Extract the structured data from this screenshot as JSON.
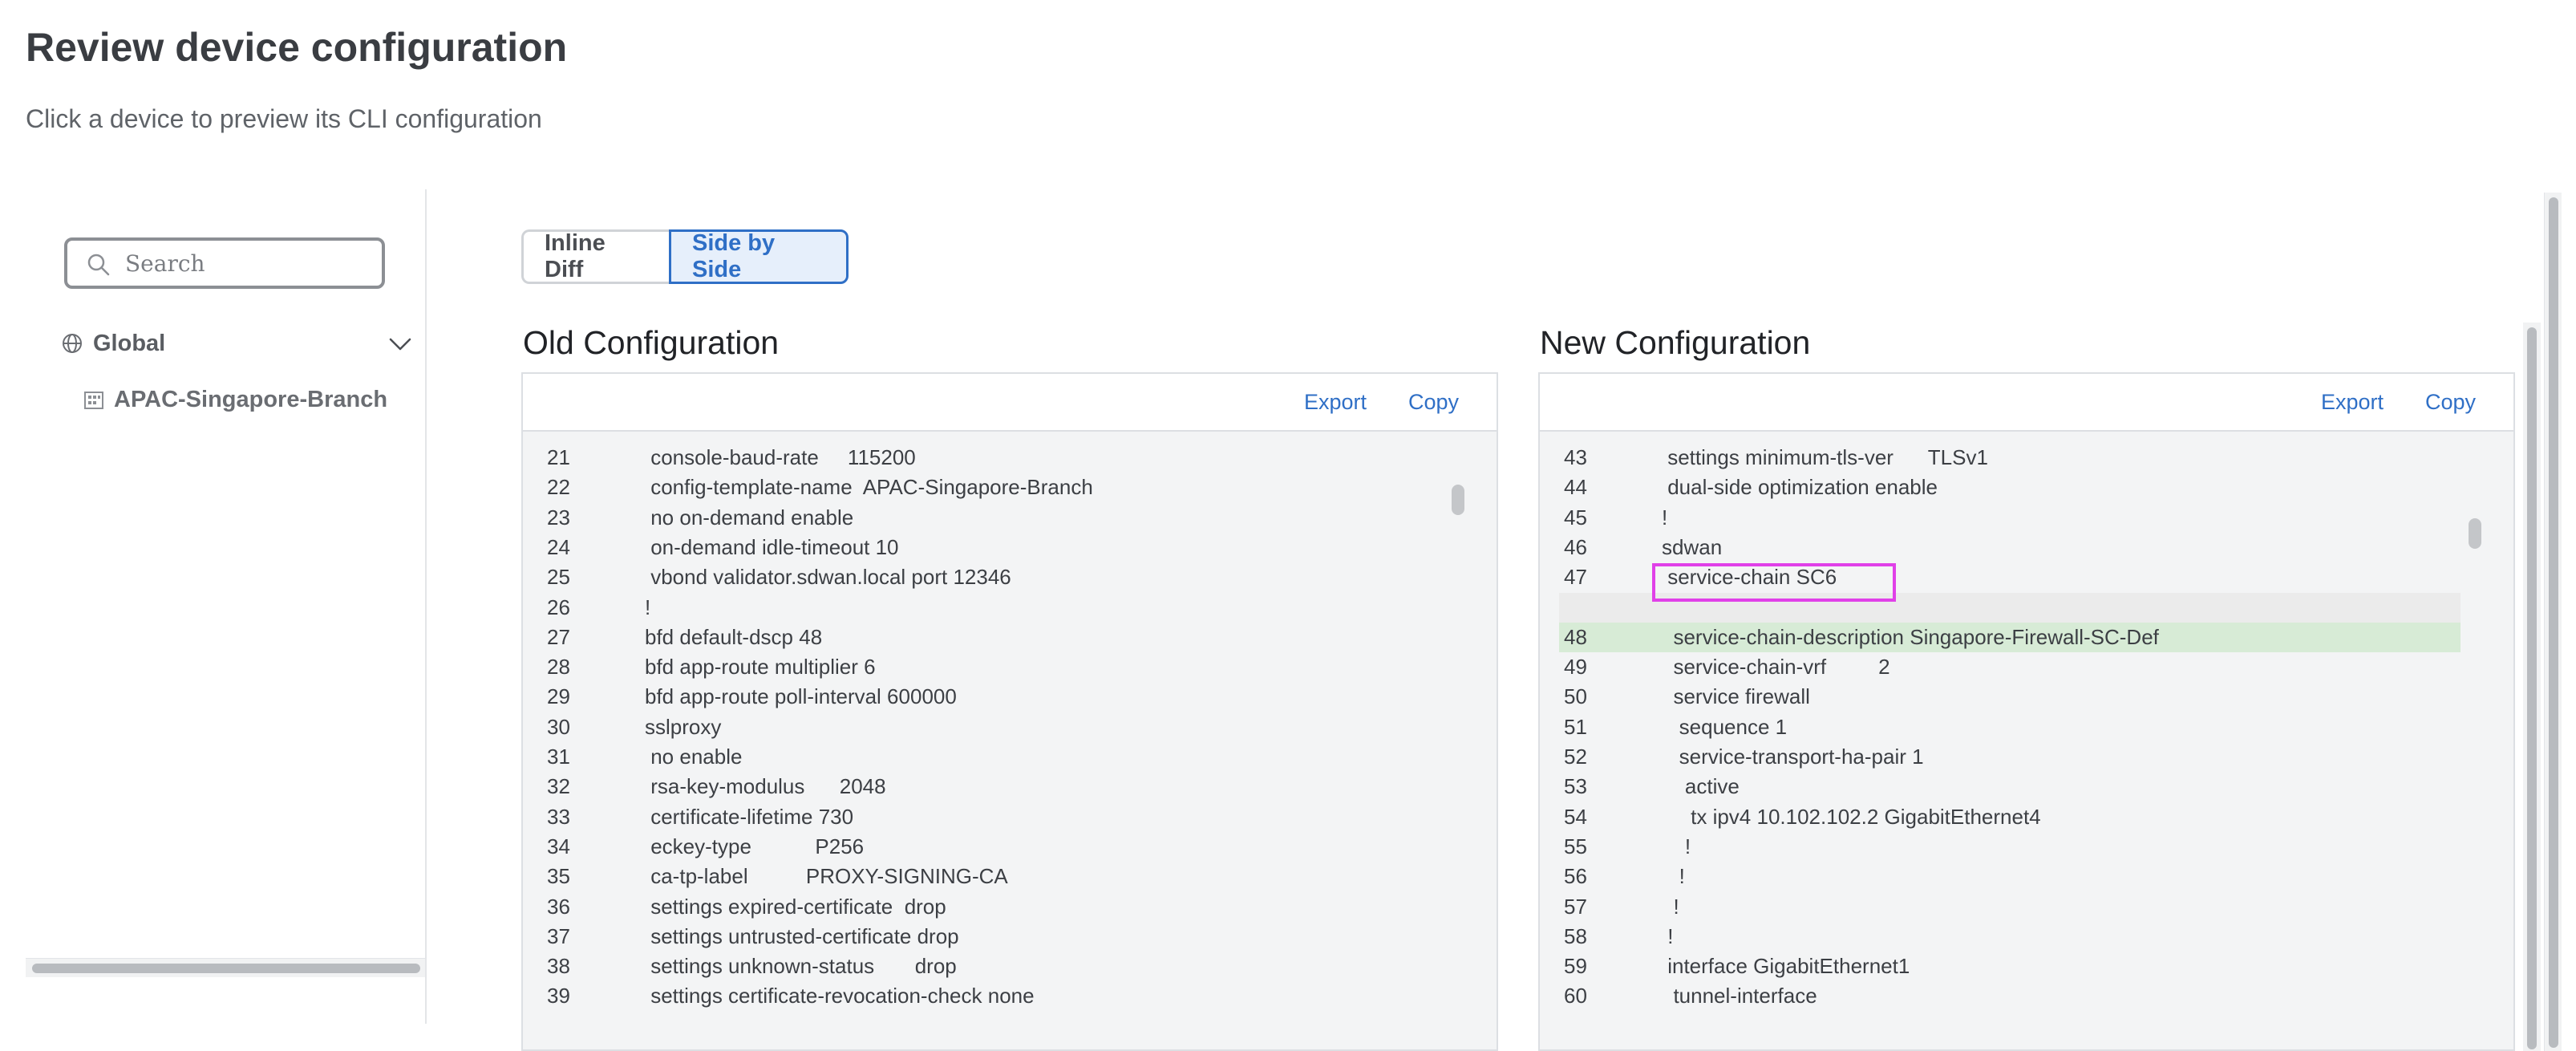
{
  "page": {
    "title": "Review device configuration",
    "subtitle": "Click a device to preview its CLI configuration"
  },
  "sidebar": {
    "search_placeholder": "Search",
    "global_label": "Global",
    "site_label": "APAC-Singapore-Branch"
  },
  "view_toggle": {
    "inline_label": "Inline Diff",
    "side_label": "Side by Side",
    "selected": "Side by Side"
  },
  "old_config": {
    "title": "Old Configuration",
    "export_label": "Export",
    "copy_label": "Copy",
    "lines": [
      {
        "num": "21",
        "text": " console-baud-rate     115200"
      },
      {
        "num": "22",
        "text": " config-template-name  APAC-Singapore-Branch"
      },
      {
        "num": "23",
        "text": " no on-demand enable"
      },
      {
        "num": "24",
        "text": " on-demand idle-timeout 10"
      },
      {
        "num": "25",
        "text": " vbond validator.sdwan.local port 12346"
      },
      {
        "num": "26",
        "text": "!"
      },
      {
        "num": "27",
        "text": "bfd default-dscp 48"
      },
      {
        "num": "28",
        "text": "bfd app-route multiplier 6"
      },
      {
        "num": "29",
        "text": "bfd app-route poll-interval 600000"
      },
      {
        "num": "30",
        "text": "sslproxy"
      },
      {
        "num": "31",
        "text": " no enable"
      },
      {
        "num": "32",
        "text": " rsa-key-modulus      2048"
      },
      {
        "num": "33",
        "text": " certificate-lifetime 730"
      },
      {
        "num": "34",
        "text": " eckey-type           P256"
      },
      {
        "num": "35",
        "text": " ca-tp-label          PROXY-SIGNING-CA"
      },
      {
        "num": "36",
        "text": " settings expired-certificate  drop"
      },
      {
        "num": "37",
        "text": " settings untrusted-certificate drop"
      },
      {
        "num": "38",
        "text": " settings unknown-status       drop"
      },
      {
        "num": "39",
        "text": " settings certificate-revocation-check none"
      }
    ]
  },
  "new_config": {
    "title": "New Configuration",
    "export_label": "Export",
    "copy_label": "Copy",
    "lines": [
      {
        "num": "43",
        "text": " settings minimum-tls-ver      TLSv1",
        "state": "normal"
      },
      {
        "num": "44",
        "text": " dual-side optimization enable",
        "state": "normal"
      },
      {
        "num": "45",
        "text": "!",
        "state": "normal"
      },
      {
        "num": "46",
        "text": "sdwan",
        "state": "normal"
      },
      {
        "num": "47",
        "text": " service-chain SC6",
        "state": "normal"
      },
      {
        "num": "",
        "text": "",
        "state": "blank"
      },
      {
        "num": "48",
        "text": "  service-chain-description Singapore-Firewall-SC-Def",
        "state": "added"
      },
      {
        "num": "49",
        "text": "  service-chain-vrf         2",
        "state": "normal"
      },
      {
        "num": "50",
        "text": "  service firewall",
        "state": "normal"
      },
      {
        "num": "51",
        "text": "   sequence 1",
        "state": "normal"
      },
      {
        "num": "52",
        "text": "   service-transport-ha-pair 1",
        "state": "normal"
      },
      {
        "num": "53",
        "text": "    active",
        "state": "normal"
      },
      {
        "num": "54",
        "text": "     tx ipv4 10.102.102.2 GigabitEthernet4",
        "state": "normal"
      },
      {
        "num": "55",
        "text": "    !",
        "state": "normal"
      },
      {
        "num": "56",
        "text": "   !",
        "state": "normal"
      },
      {
        "num": "57",
        "text": "  !",
        "state": "normal"
      },
      {
        "num": "58",
        "text": " !",
        "state": "normal"
      },
      {
        "num": "59",
        "text": " interface GigabitEthernet1",
        "state": "normal"
      },
      {
        "num": "60",
        "text": "  tunnel-interface",
        "state": "normal"
      }
    ]
  },
  "colors": {
    "accent": "#2f6fc6",
    "added_line": "#d7ebd6",
    "highlight": "#e040e8"
  }
}
